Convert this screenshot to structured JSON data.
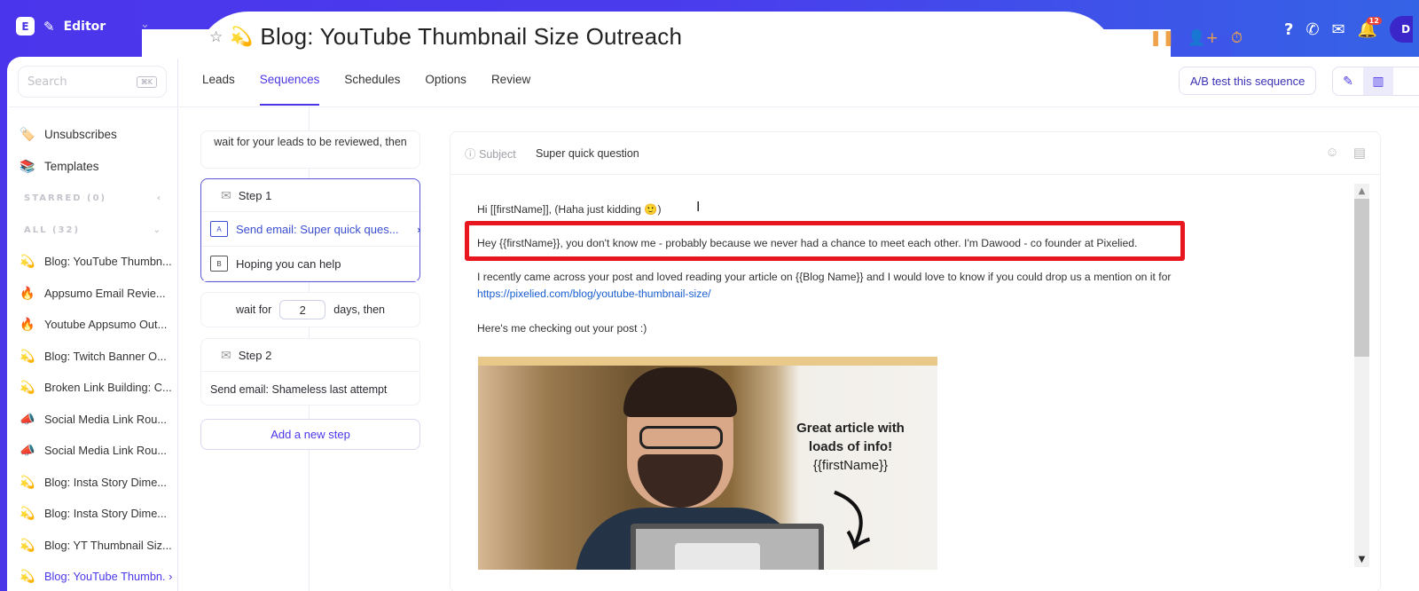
{
  "header": {
    "app_label": "Editor",
    "logo_letter": "E",
    "notification_count": "12",
    "avatar_letter": "D"
  },
  "campaign": {
    "title": "Blog: YouTube Thumbnail Size Outreach",
    "emoji": "💫"
  },
  "sidebar": {
    "search_placeholder": "Search",
    "search_shortcut": "⌘K",
    "links": [
      {
        "label": "Unsubscribes",
        "icon": "🏷️"
      },
      {
        "label": "Templates",
        "icon": "📚"
      }
    ],
    "starred_label": "STARRED (0)",
    "all_label": "ALL (32)",
    "items": [
      {
        "label": "Blog: YouTube Thumbn...",
        "icon": "💫"
      },
      {
        "label": "Appsumo Email Revie...",
        "icon": "🔥"
      },
      {
        "label": "Youtube Appsumo Out...",
        "icon": "🔥"
      },
      {
        "label": "Blog: Twitch Banner O...",
        "icon": "💫"
      },
      {
        "label": "Broken Link Building: C...",
        "icon": "💫"
      },
      {
        "label": "Social Media Link Rou...",
        "icon": "📣"
      },
      {
        "label": "Social Media Link Rou...",
        "icon": "📣"
      },
      {
        "label": "Blog: Insta Story Dime...",
        "icon": "💫"
      },
      {
        "label": "Blog: Insta Story Dime...",
        "icon": "💫"
      },
      {
        "label": "Blog: YT Thumbnail Siz...",
        "icon": "💫"
      },
      {
        "label": "Blog: YouTube Thumbn. ›",
        "icon": "💫",
        "active": true
      }
    ]
  },
  "tabs": [
    "Leads",
    "Sequences",
    "Schedules",
    "Options",
    "Review"
  ],
  "active_tab": "Sequences",
  "toolbar": {
    "ab_test_label": "A/B test this sequence"
  },
  "sequence": {
    "initial_wait": "wait for your leads to be reviewed, then",
    "step1": {
      "label": "Step 1",
      "variants": [
        {
          "tag": "A",
          "label": "Send email: Super quick ques..."
        },
        {
          "tag": "B",
          "label": "Hoping you can help"
        }
      ]
    },
    "wait": {
      "prefix": "wait for",
      "days": "2",
      "suffix": "days, then"
    },
    "step2": {
      "label": "Step 2",
      "email": "Send email: Shameless last attempt"
    },
    "add_step_label": "Add a new step"
  },
  "editor": {
    "subject_label": "Subject",
    "subject_value": "Super quick question",
    "greeting": "Hi [[firstName]], (Haha just kidding 🙂)",
    "highlighted_line": "Hey {{firstName}}, you don't know me - probably because we never had a chance to meet each other. I'm Dawood - co founder at Pixelied.",
    "paragraph": "I recently came across your post and loved reading your article on {{Blog Name}} and I would love to know if you could drop us a mention on it for ",
    "link": "https://pixelied.com/blog/youtube-thumbnail-size/",
    "checking_line": "Here's me checking out your post :)",
    "image_caption_line1": "Great article with",
    "image_caption_line2": "loads of info!",
    "image_caption_line3": "{{firstName}}"
  },
  "colors": {
    "brand": "#4a37e8",
    "highlight_border": "#e8161e",
    "link": "#1a5fd0",
    "warning_icons": "#f0a24a"
  }
}
